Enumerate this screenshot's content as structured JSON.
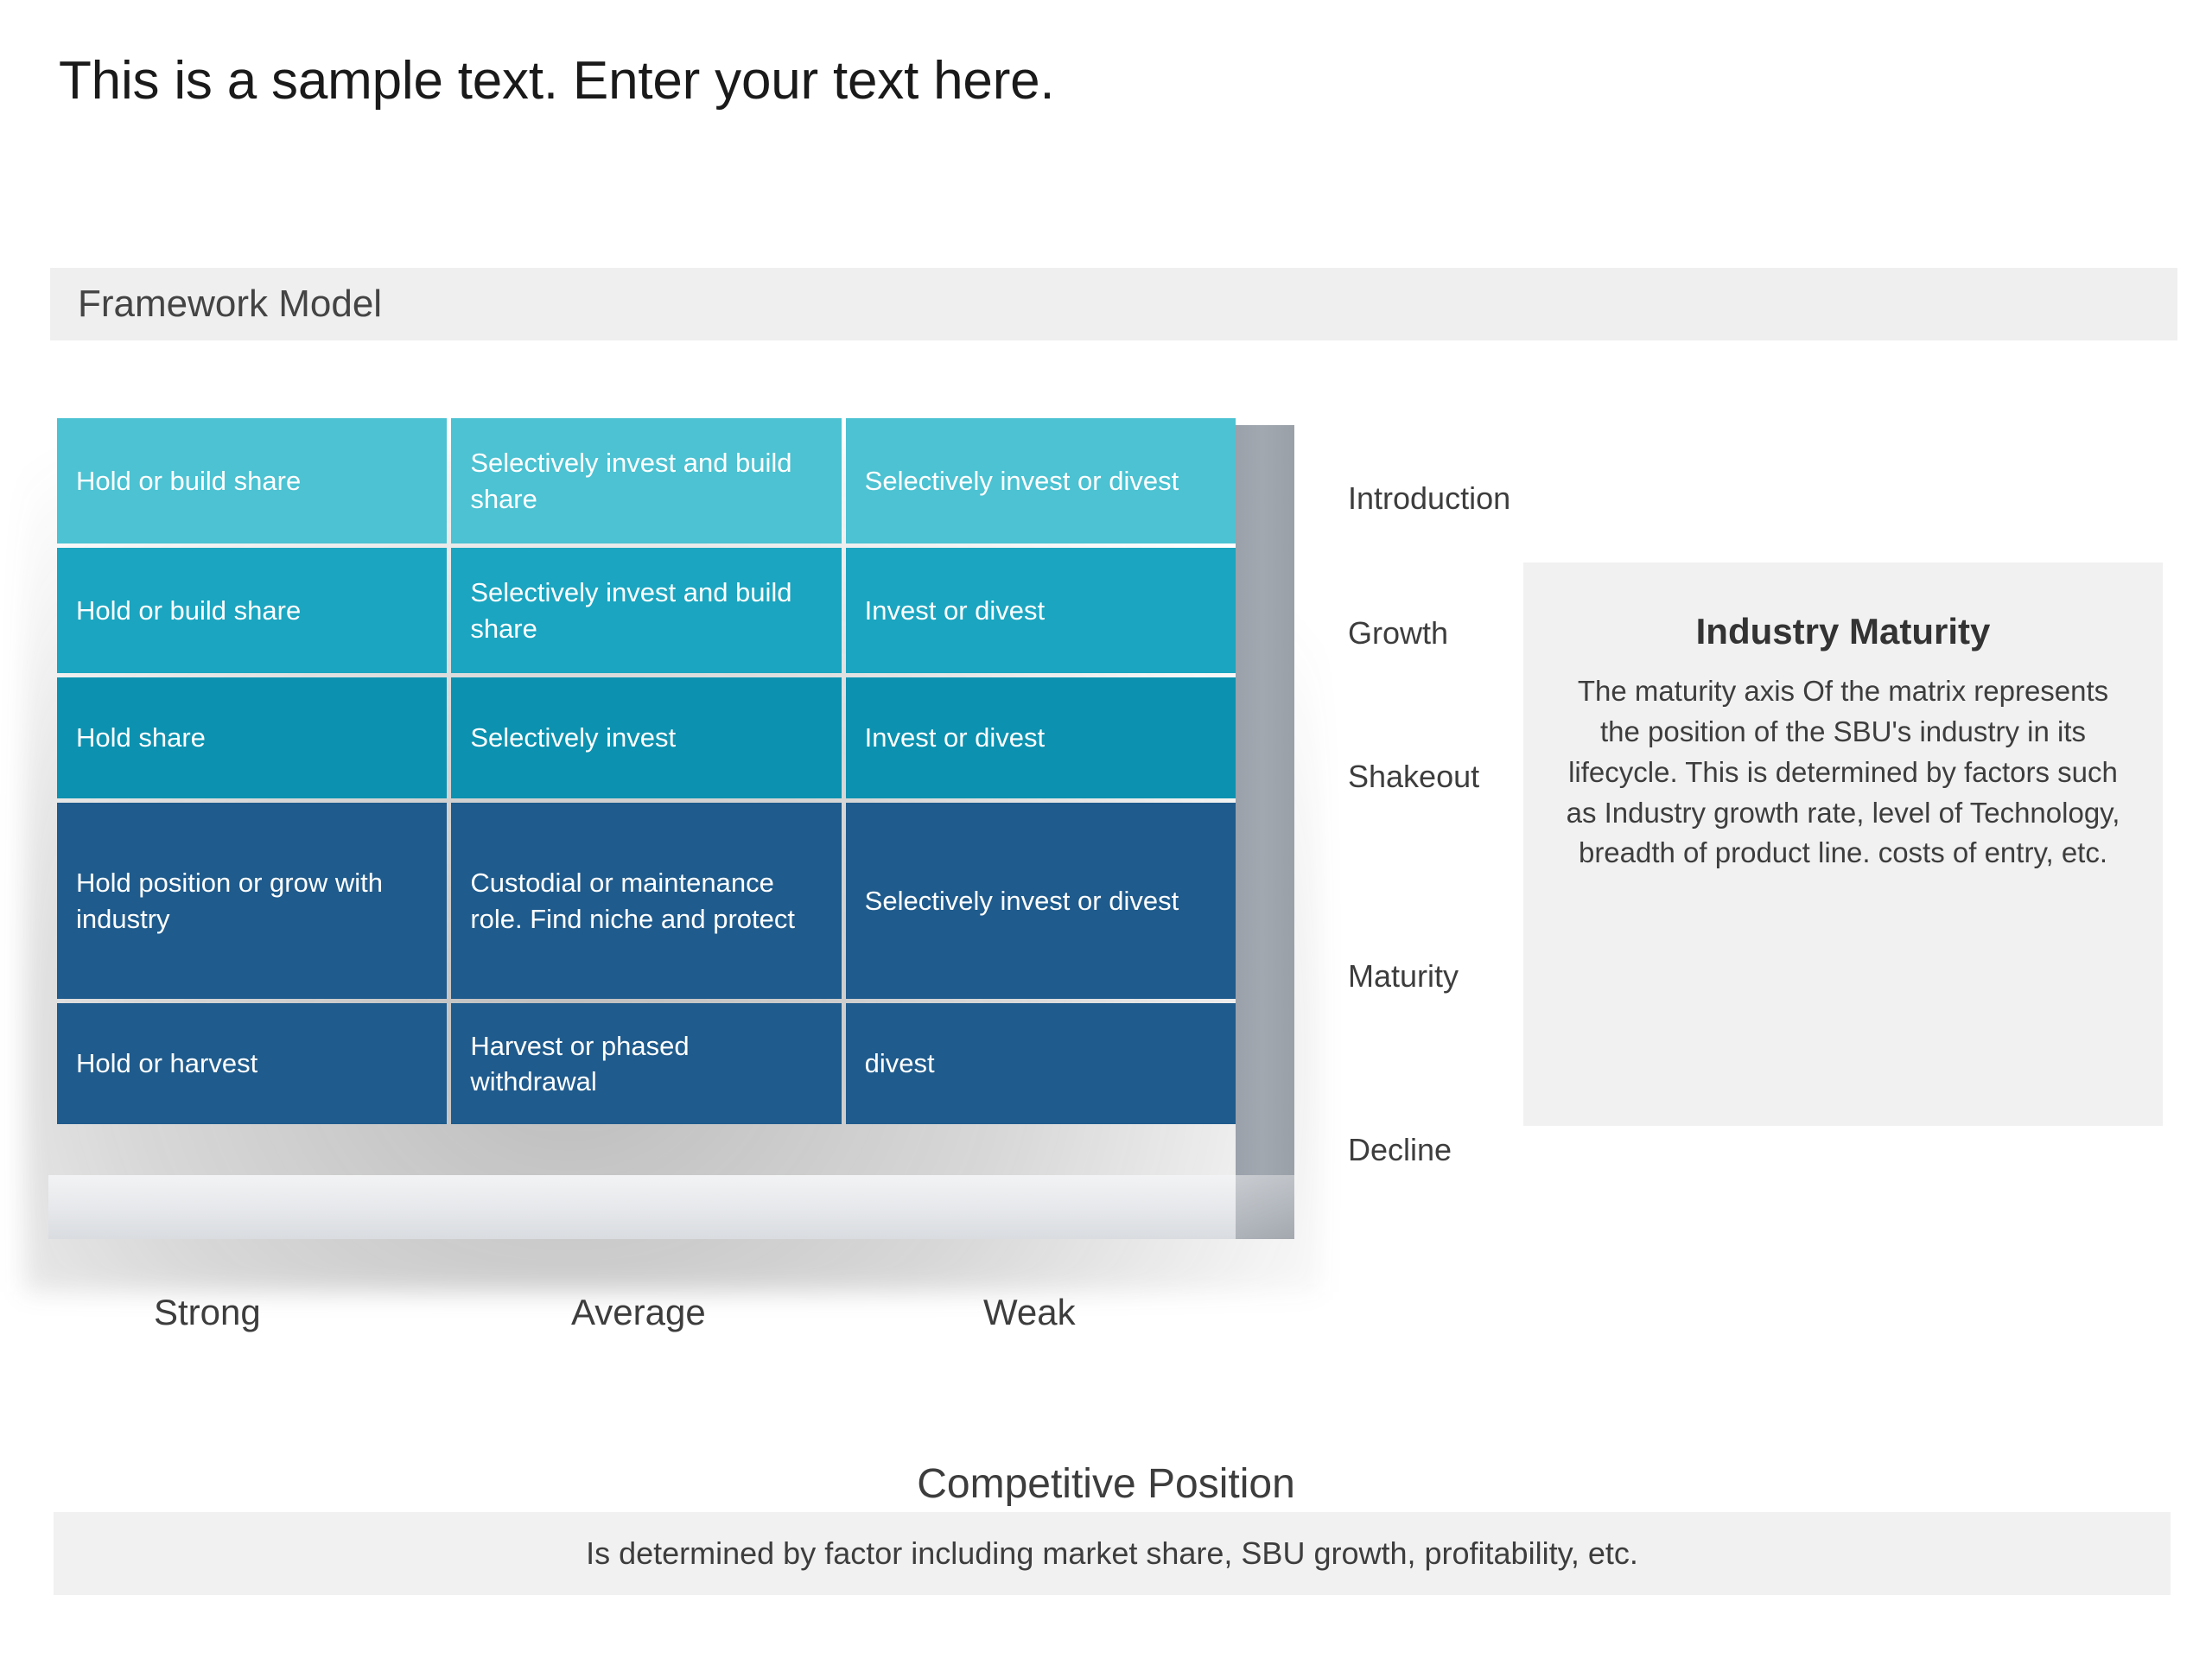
{
  "slide": {
    "title": "This is a sample text. Enter your text here."
  },
  "section": {
    "label": "Framework Model"
  },
  "matrix": {
    "colors": {
      "row1": "#4cc2d2",
      "row2": "#1ba5c0",
      "row3": "#0c92b0",
      "row4": "#1f5b8c",
      "row5": "#1f5b8c",
      "grid_line": "#ffffff",
      "slab_side": "#a2a8b0",
      "slab_bottom": "#e7e9ec"
    },
    "column_labels": [
      "Strong",
      "Average",
      "Weak"
    ],
    "row_labels": [
      "Introduction",
      "Growth",
      "Shakeout",
      "Maturity",
      "Decline"
    ],
    "rows": [
      {
        "label": "Introduction",
        "cells": [
          "Hold or build share",
          "Selectively invest and build share",
          "Selectively invest or divest"
        ]
      },
      {
        "label": "Growth",
        "cells": [
          "Hold or build share",
          "Selectively invest and build share",
          "Invest or divest"
        ]
      },
      {
        "label": "Shakeout",
        "cells": [
          "Hold share",
          "Selectively invest",
          "Invest or divest"
        ]
      },
      {
        "label": "Maturity",
        "cells": [
          "Hold position or grow with industry",
          "Custodial or maintenance role. Find niche and protect",
          "Selectively invest or divest"
        ]
      },
      {
        "label": "Decline",
        "cells": [
          "Hold or harvest",
          "Harvest or phased withdrawal",
          "divest"
        ]
      }
    ]
  },
  "side_panel": {
    "title": "Industry Maturity",
    "body": "The maturity axis Of the matrix represents the position of the SBU's industry in its lifecycle. This is determined by factors such as Industry growth rate, level of Technology, breadth of product line. costs of entry, etc."
  },
  "footer": {
    "title": "Competitive Position",
    "description": "Is determined by factor including market share, SBU growth, profitability, etc."
  }
}
